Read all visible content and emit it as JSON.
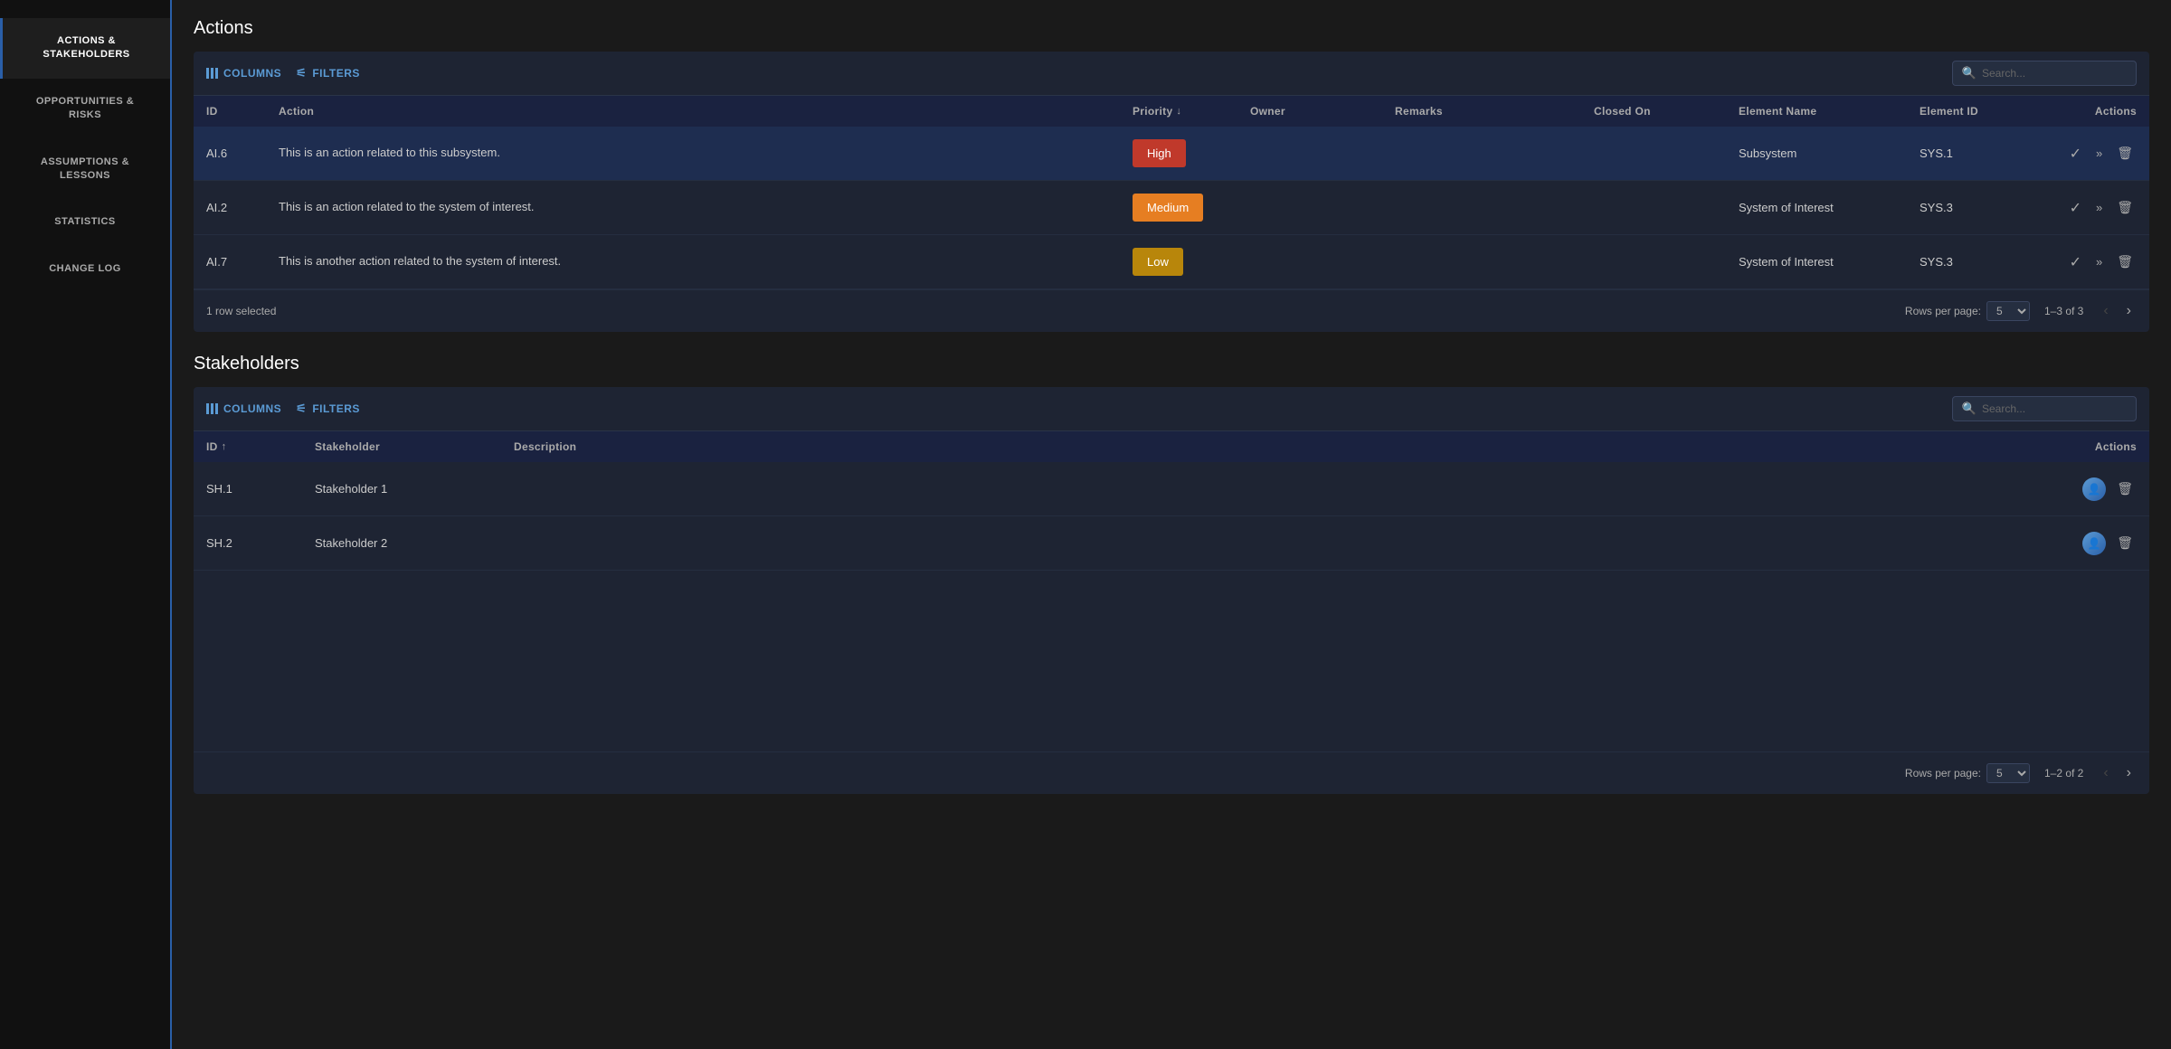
{
  "sidebar": {
    "items": [
      {
        "id": "actions-stakeholders",
        "label": "ACTIONS &\nSTAKEHOLDERS",
        "active": true
      },
      {
        "id": "opportunities-risks",
        "label": "OPPORTUNITIES &\nRISKS",
        "active": false
      },
      {
        "id": "assumptions-lessons",
        "label": "ASSUMPTIONS &\nLESSONS",
        "active": false
      },
      {
        "id": "statistics",
        "label": "STATISTICS",
        "active": false
      },
      {
        "id": "change-log",
        "label": "CHANGE LOG",
        "active": false
      }
    ]
  },
  "actions": {
    "title": "Actions",
    "toolbar": {
      "columns_label": "COLUMNS",
      "filters_label": "FILTERS",
      "search_placeholder": "Search..."
    },
    "columns": {
      "id": "ID",
      "action": "Action",
      "priority": "Priority",
      "owner": "Owner",
      "remarks": "Remarks",
      "closed_on": "Closed On",
      "element_name": "Element Name",
      "element_id": "Element ID",
      "actions": "Actions"
    },
    "rows": [
      {
        "id": "AI.6",
        "action": "This is an action related to this subsystem.",
        "priority": "High",
        "priority_class": "priority-high",
        "owner": "",
        "remarks": "",
        "closed_on": "",
        "element_name": "Subsystem",
        "element_id": "SYS.1",
        "selected": true
      },
      {
        "id": "AI.2",
        "action": "This is an action related to the system of interest.",
        "priority": "Medium",
        "priority_class": "priority-medium",
        "owner": "",
        "remarks": "",
        "closed_on": "",
        "element_name": "System of Interest",
        "element_id": "SYS.3",
        "selected": false
      },
      {
        "id": "AI.7",
        "action": "This is another action related to the system of interest.",
        "priority": "Low",
        "priority_class": "priority-low",
        "owner": "",
        "remarks": "",
        "closed_on": "",
        "element_name": "System of Interest",
        "element_id": "SYS.3",
        "selected": false
      }
    ],
    "footer": {
      "selected_text": "1 row selected",
      "rows_per_page_label": "Rows per page:",
      "rows_per_page_value": "5",
      "page_info": "1–3 of 3"
    }
  },
  "stakeholders": {
    "title": "Stakeholders",
    "toolbar": {
      "columns_label": "COLUMNS",
      "filters_label": "FILTERS",
      "search_placeholder": "Search..."
    },
    "columns": {
      "id": "ID",
      "stakeholder": "Stakeholder",
      "description": "Description",
      "actions": "Actions"
    },
    "rows": [
      {
        "id": "SH.1",
        "stakeholder": "Stakeholder 1",
        "description": ""
      },
      {
        "id": "SH.2",
        "stakeholder": "Stakeholder 2",
        "description": ""
      }
    ],
    "footer": {
      "selected_text": "",
      "rows_per_page_label": "Rows per page:",
      "rows_per_page_value": "5",
      "page_info": "1–2 of 2"
    }
  }
}
